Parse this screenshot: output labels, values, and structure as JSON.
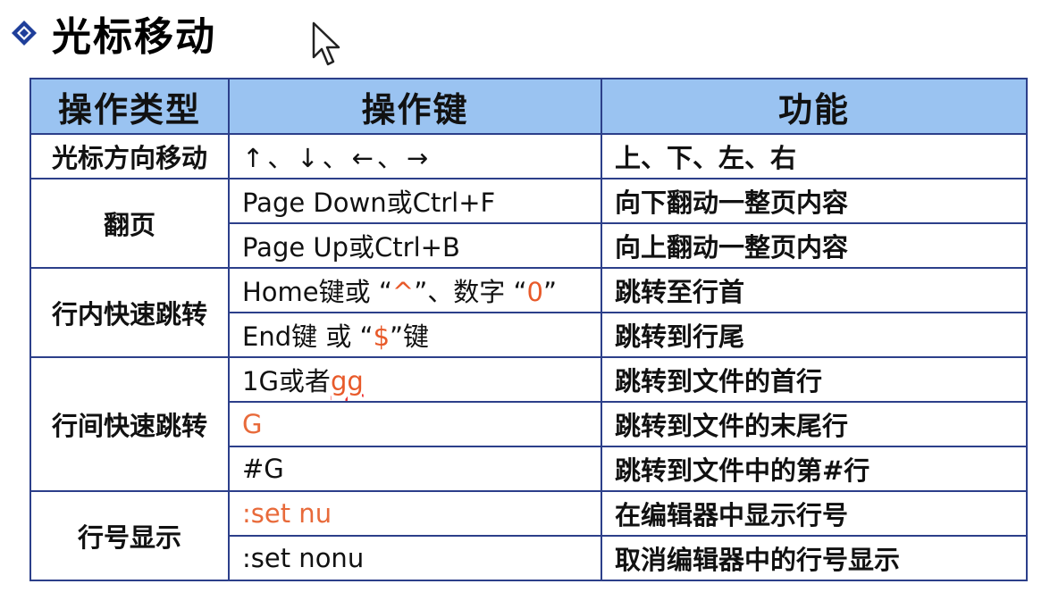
{
  "title": "光标移动",
  "table": {
    "headers": [
      "操作类型",
      "操作键",
      "功能"
    ],
    "groups": {
      "cursor_dir": {
        "type": "光标方向移动",
        "keys": "↑、↓、←、→",
        "func": "上、下、左、右"
      },
      "page": {
        "type": "翻页",
        "rows": [
          {
            "keys": "Page Down或Ctrl+F",
            "func": "向下翻动一整页内容"
          },
          {
            "keys": "Page Up或Ctrl+B",
            "func": "向上翻动一整页内容"
          }
        ]
      },
      "inline_jump": {
        "type": "行内快速跳转",
        "row1": {
          "keys_a": "Home键或 “",
          "keys_b": "^",
          "keys_c": "”、数字 “",
          "keys_d": "0",
          "keys_e": "”",
          "func": "跳转至行首"
        },
        "row2": {
          "keys_a": "End键 或 “",
          "keys_b": "$",
          "keys_c": "”键",
          "func": "跳转到行尾"
        }
      },
      "line_jump": {
        "type": "行间快速跳转",
        "row1": {
          "keys_a": "1G或者",
          "keys_b": "gg",
          "func": "跳转到文件的首行"
        },
        "row2": {
          "keys": "G",
          "func": "跳转到文件的末尾行"
        },
        "row3": {
          "keys": "#G",
          "func": "跳转到文件中的第#行"
        }
      },
      "line_number": {
        "type": "行号显示",
        "rows": [
          {
            "keys": ":set nu",
            "func": "在编辑器中显示行号"
          },
          {
            "keys": ":set nonu",
            "func": "取消编辑器中的行号显示"
          }
        ]
      }
    }
  },
  "colors": {
    "header_bg": "#9ac3f1",
    "border": "#2c3f8a",
    "highlight": "#e85a2a",
    "bullet": "#1f3f9a"
  },
  "icons": {
    "bullet": "diamond-bullet-icon",
    "cursor": "mouse-pointer-icon"
  }
}
